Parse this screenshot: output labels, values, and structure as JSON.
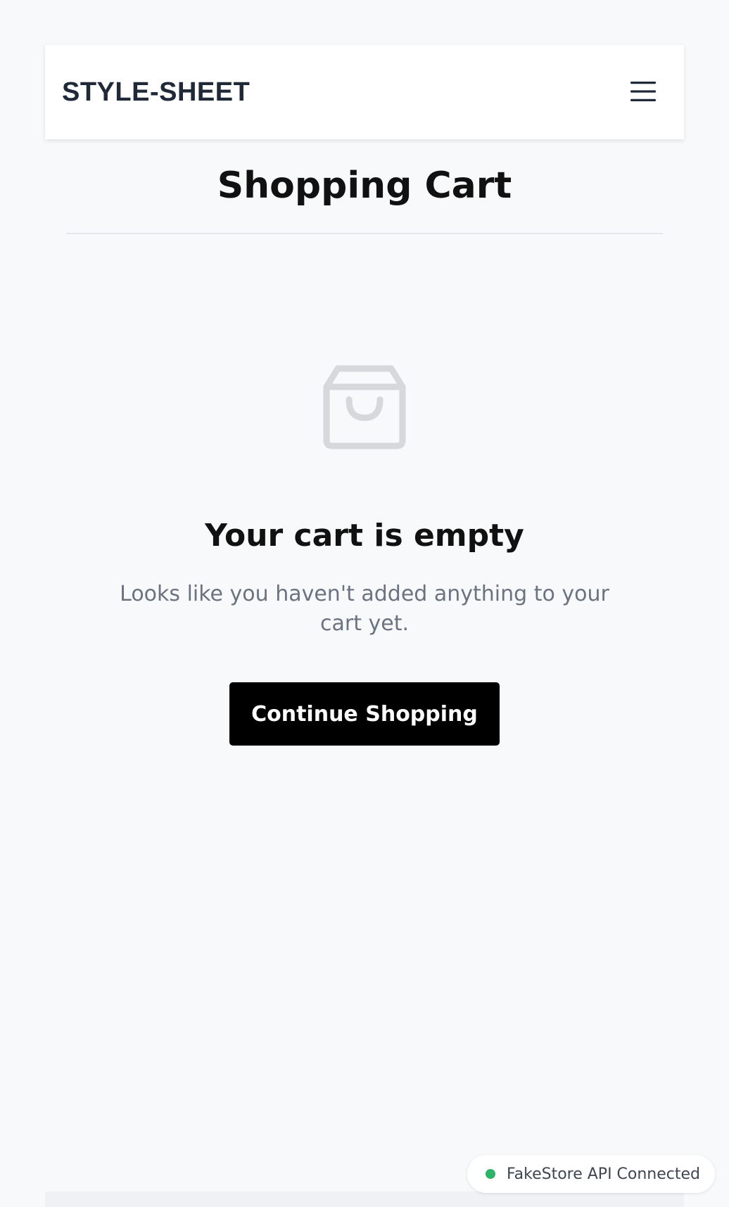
{
  "header": {
    "brand": "STYLE-SHEET",
    "menu_icon": "hamburger-menu-icon"
  },
  "page": {
    "title": "Shopping Cart"
  },
  "empty_state": {
    "icon": "shopping-bag-icon",
    "heading": "Your cart is empty",
    "message": "Looks like you haven't added anything to your cart yet.",
    "button_label": "Continue Shopping"
  },
  "status": {
    "text": "FakeStore API Connected",
    "dot_color": "#2fb36b"
  },
  "colors": {
    "background": "#f8f9fb",
    "primary_button": "#000000",
    "brand_text": "#1f2937",
    "muted_text": "#6b7280"
  }
}
